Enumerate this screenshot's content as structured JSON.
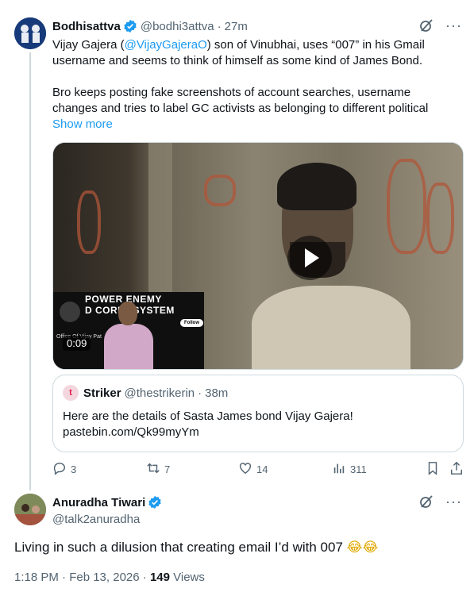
{
  "tweet1": {
    "name": "Bodhisattva",
    "handle": "@bodhi3attva",
    "separator": "·",
    "time": "27m",
    "text_line1_a": "Vijay Gajera (",
    "text_line1_mention": "@VijayGajeraO",
    "text_line1_b": ") son of Vinubhai, uses “007” in his Gmail",
    "text_line2": "username and seems to think of himself as some kind of James Bond.",
    "text_line3": "Bro keeps posting fake screenshots of account searches, username",
    "text_line4": "changes and tries to label GC activists as belonging to different political",
    "show_more": "Show more",
    "video": {
      "duration": "0:09",
      "thumb_banner_1": "POWER    ENEMY",
      "thumb_banner_2": "D CORI  T SYSTEM",
      "thumb_follow": "Follow",
      "thumb_office": "Office Of Vijay Pat"
    },
    "quote": {
      "avatar_letter": "t",
      "name": "Striker",
      "handle": "@thestrikerin",
      "separator": "·",
      "time": "38m",
      "text_line1": "Here are the details of Sasta James bond Vijay Gajera!",
      "text_line2": "pastebin.com/Qk99myYm"
    },
    "actions": {
      "replies": "3",
      "reposts": "7",
      "likes": "14",
      "views": "311"
    }
  },
  "tweet2": {
    "name": "Anuradha Tiwari",
    "handle": "@talk2anuradha",
    "text": "Living in such a dilusion that creating email I’d with 007",
    "emoji": "😂😂",
    "meta_time": "1:18 PM · Feb 13, 2026 · ",
    "meta_views_count": "149",
    "meta_views_label": " Views"
  },
  "colors": {
    "accent": "#1d9bf0",
    "muted": "#536471",
    "border": "#cfd9de"
  },
  "icons": [
    "verified-badge-icon",
    "grok-icon",
    "more-icon",
    "play-icon",
    "reply-icon",
    "repost-icon",
    "like-icon",
    "views-icon",
    "bookmark-icon",
    "share-icon"
  ]
}
